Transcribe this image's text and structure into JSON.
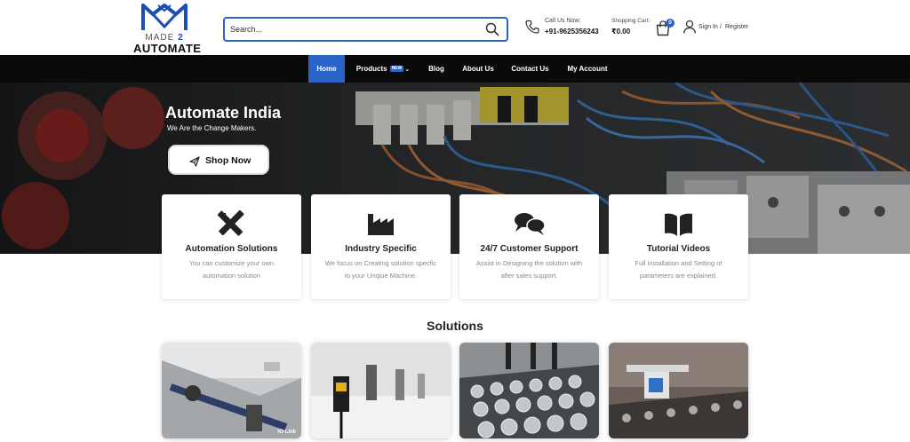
{
  "header": {
    "logo": {
      "made": "MADE",
      "two": "2",
      "automate": "AUTOMATE"
    },
    "search": {
      "placeholder": "Search..."
    },
    "call": {
      "label": "Call Us Now:",
      "number": "+91-9625356243"
    },
    "cart": {
      "label": "Shopping Cart:",
      "amount": "₹0.00",
      "count": "0"
    },
    "account": {
      "signin": "Sign In",
      "separator": "/",
      "register": "Register"
    }
  },
  "nav": {
    "items": [
      {
        "label": "Home"
      },
      {
        "label": "Products",
        "badge": "NEW"
      },
      {
        "label": "Blog"
      },
      {
        "label": "About Us"
      },
      {
        "label": "Contact Us"
      },
      {
        "label": "My Account"
      }
    ]
  },
  "hero": {
    "title": "Automate India",
    "subtitle": "We Are the Change Makers.",
    "cta": "Shop Now"
  },
  "features": [
    {
      "icon": "pencil-ruler-icon",
      "title": "Automation Solutions",
      "desc": "You can customize your own automation solution"
    },
    {
      "icon": "factory-icon",
      "title": "Industry Specific",
      "desc": "We focus on Creating solution specfic to your Unqiue Machine."
    },
    {
      "icon": "chat-bubbles-icon",
      "title": "24/7 Customer Support",
      "desc": "Assist in Designing the solution with after sales support."
    },
    {
      "icon": "book-open-icon",
      "title": "Tutorial Videos",
      "desc": "Full installation and Setting of parameters are explained."
    }
  ],
  "solutions": {
    "title": "Solutions",
    "cards": [
      {
        "overlay": "IO-Link"
      },
      {
        "overlay": ""
      },
      {
        "overlay": ""
      },
      {
        "overlay": ""
      }
    ]
  },
  "colors": {
    "accent": "#2b63c9",
    "nav_bg": "#0a0a0a"
  }
}
